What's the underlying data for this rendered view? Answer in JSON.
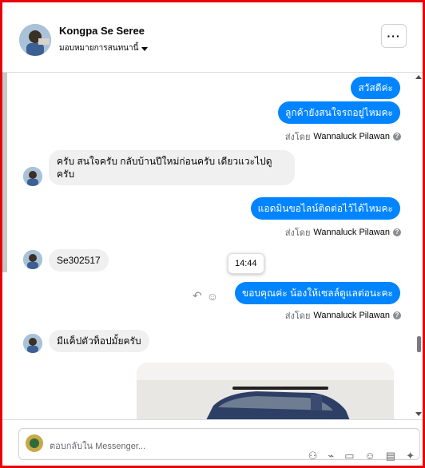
{
  "header": {
    "name": "Kongpa Se Seree",
    "assign_label": "มอบหมายการสนทนานี้",
    "more_label": "···"
  },
  "messages": {
    "m1": "สวัสดีค่ะ",
    "m2": "ลูกค้ายังสนใจรถอยู่ไหมคะ",
    "m3": "ครับ สนใจครับ กลับบ้านปีใหม่ก่อนครับ เดียวแวะไปดูครับ",
    "m4": "แอดมินขอไลน์ติดต่อไว้ได้ไหมคะ",
    "m5": "Se302517",
    "m6": "ขอบคุณค่ะ น้องให้เซลล์ดูแลต่อนะคะ",
    "m7": "มีแค็ปตัวท็อปมั้ยครับ"
  },
  "sent_by": {
    "prefix": "ส่งโดย",
    "agent": "Wannaluck Pilawan",
    "help": "?"
  },
  "tooltip_time": "14:44",
  "composer": {
    "placeholder": "ตอบกลับใน Messenger..."
  },
  "colors": {
    "accent": "#0084ff",
    "frame": "#e8000b",
    "incoming": "#f0f0f0"
  }
}
